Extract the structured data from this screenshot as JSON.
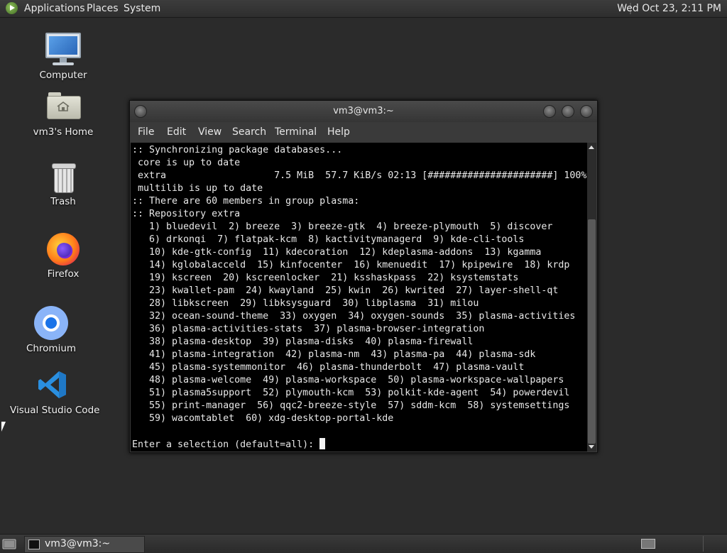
{
  "top_panel": {
    "menus": [
      "Applications",
      "Places",
      "System"
    ],
    "clock": "Wed Oct 23,  2:11 PM"
  },
  "desktop": {
    "icons": [
      {
        "label": "Computer",
        "icon": "computer-icon"
      },
      {
        "label": "vm3's Home",
        "icon": "home-folder-icon"
      },
      {
        "label": "Trash",
        "icon": "trash-icon"
      },
      {
        "label": "Firefox",
        "icon": "firefox-icon"
      },
      {
        "label": "Chromium",
        "icon": "chromium-icon"
      },
      {
        "label": "Visual Studio Code",
        "icon": "vscode-icon"
      }
    ]
  },
  "terminal": {
    "title": "vm3@vm3:~",
    "menu": [
      "File",
      "Edit",
      "View",
      "Search",
      "Terminal",
      "Help"
    ],
    "lines": [
      ":: Synchronizing package databases...",
      " core is up to date",
      " extra                   7.5 MiB  57.7 KiB/s 02:13 [######################] 100%",
      " multilib is up to date",
      ":: There are 60 members in group plasma:",
      ":: Repository extra",
      "   1) bluedevil  2) breeze  3) breeze-gtk  4) breeze-plymouth  5) discover",
      "   6) drkonqi  7) flatpak-kcm  8) kactivitymanagerd  9) kde-cli-tools",
      "   10) kde-gtk-config  11) kdecoration  12) kdeplasma-addons  13) kgamma",
      "   14) kglobalacceld  15) kinfocenter  16) kmenuedit  17) kpipewire  18) krdp",
      "   19) kscreen  20) kscreenlocker  21) ksshaskpass  22) ksystemstats",
      "   23) kwallet-pam  24) kwayland  25) kwin  26) kwrited  27) layer-shell-qt",
      "   28) libkscreen  29) libksysguard  30) libplasma  31) milou",
      "   32) ocean-sound-theme  33) oxygen  34) oxygen-sounds  35) plasma-activities",
      "   36) plasma-activities-stats  37) plasma-browser-integration",
      "   38) plasma-desktop  39) plasma-disks  40) plasma-firewall",
      "   41) plasma-integration  42) plasma-nm  43) plasma-pa  44) plasma-sdk",
      "   45) plasma-systemmonitor  46) plasma-thunderbolt  47) plasma-vault",
      "   48) plasma-welcome  49) plasma-workspace  50) plasma-workspace-wallpapers",
      "   51) plasma5support  52) plymouth-kcm  53) polkit-kde-agent  54) powerdevil",
      "   55) print-manager  56) qqc2-breeze-style  57) sddm-kcm  58) systemsettings",
      "   59) wacomtablet  60) xdg-desktop-portal-kde",
      ""
    ],
    "prompt": "Enter a selection (default=all): "
  },
  "taskbar": {
    "task_label": "vm3@vm3:~"
  }
}
